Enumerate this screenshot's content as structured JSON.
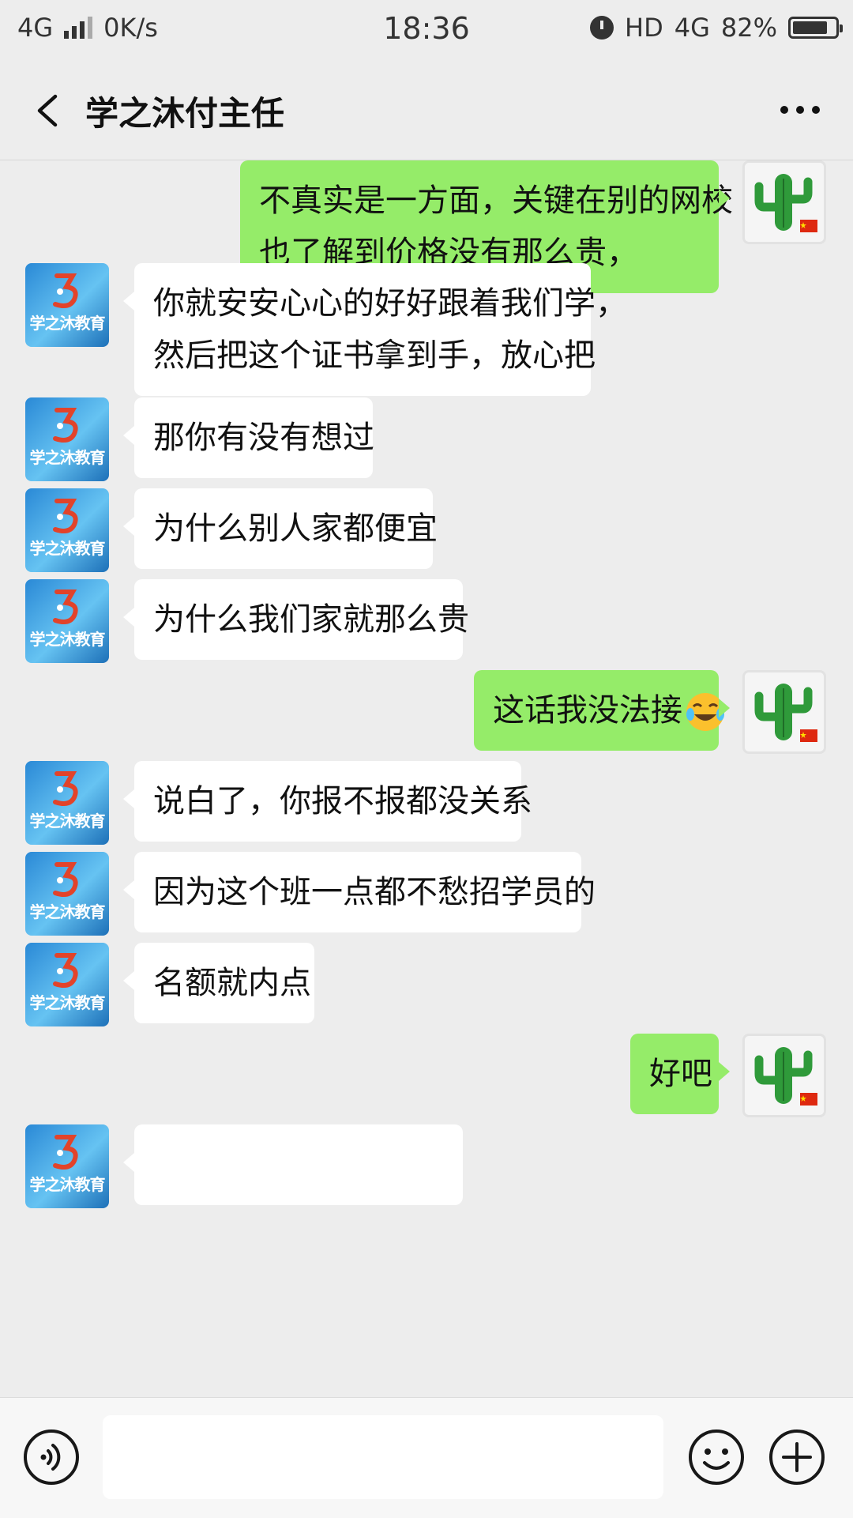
{
  "status_bar": {
    "network": "4G",
    "speed": "0K/s",
    "time": "18:36",
    "hd": "HD",
    "network_right": "4G",
    "battery": "82%",
    "battery_level": 0.82
  },
  "header": {
    "title": "学之沐付主任"
  },
  "avatars": {
    "org_text": "学之沐教育",
    "org_color": "#2a89d6",
    "user_icon": "cactus-icon"
  },
  "messages": [
    {
      "side": "right",
      "lines": [
        "不真实是一方面，关键在别的网校",
        "也了解到价格没有那么贵，"
      ]
    },
    {
      "side": "left",
      "lines": [
        "你就安安心心的好好跟着我们学，",
        "然后把这个证书拿到手，放心把"
      ]
    },
    {
      "side": "left",
      "lines": [
        "那你有没有想过"
      ]
    },
    {
      "side": "left",
      "lines": [
        "为什么别人家都便宜"
      ]
    },
    {
      "side": "left",
      "lines": [
        "为什么我们家就那么贵"
      ]
    },
    {
      "side": "right",
      "lines": [
        "这话我没法接"
      ],
      "emoji": "crying-laughing-emoji"
    },
    {
      "side": "left",
      "lines": [
        "说白了，你报不报都没关系"
      ]
    },
    {
      "side": "left",
      "lines": [
        "因为这个班一点都不愁招学员的"
      ]
    },
    {
      "side": "left",
      "lines": [
        "名额就内点"
      ]
    },
    {
      "side": "right",
      "lines": [
        "好吧"
      ]
    },
    {
      "side": "left",
      "lines": [
        ""
      ]
    }
  ],
  "input_bar": {
    "voice_icon": "voice-icon",
    "emoji_icon": "smiley-icon",
    "add_icon": "plus-circle-icon"
  },
  "colors": {
    "background": "#ededed",
    "self_bubble": "#95ec69",
    "other_bubble": "#ffffff"
  }
}
